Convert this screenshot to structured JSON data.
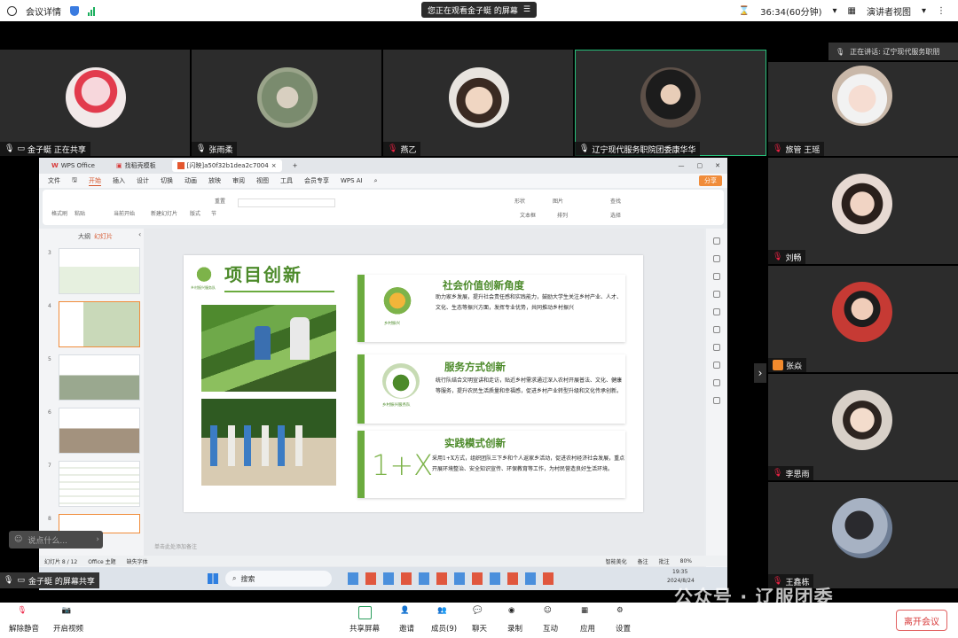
{
  "topbar": {
    "meeting_details": "会议详情",
    "viewing_notice": "您正在观看金子蜓 的屏幕",
    "timer": "36:34(60分钟)",
    "view_mode": "演讲者视图"
  },
  "speaker_bar": {
    "text": "正在讲话: 辽宁现代服务职朋"
  },
  "participants_top": [
    {
      "name": "金子蜓 正在共享"
    },
    {
      "name": "张雨柔"
    },
    {
      "name": "燕乙"
    },
    {
      "name": "辽宁现代服务职院团委康华华"
    }
  ],
  "participants_right": [
    {
      "name": "旅管 王瑶"
    },
    {
      "name": "刘畅"
    },
    {
      "name": "张焱"
    },
    {
      "name": "李思雨"
    },
    {
      "name": "王鑫栋"
    }
  ],
  "wps": {
    "tabs": [
      "WPS Office",
      "找稻壳模板",
      "[闪映]a50f32b1dea2c7004"
    ],
    "menu": [
      "文件",
      "开始",
      "插入",
      "设计",
      "切换",
      "动画",
      "放映",
      "审阅",
      "视图",
      "工具",
      "会员专享",
      "WPS AI"
    ],
    "share_btn": "分享",
    "ribbon": [
      "格式刷",
      "粘贴",
      "当前开始",
      "新建幻灯片",
      "版式",
      "节",
      "重置"
    ],
    "ribbon_right": [
      "形状",
      "图片",
      "查找",
      "文本框",
      "排列",
      "选择"
    ],
    "pane_tabs": [
      "大纲",
      "幻灯片"
    ],
    "thumb_numbers": [
      "3",
      "4",
      "5",
      "6",
      "7",
      "8"
    ],
    "notes_placeholder": "单击此处添加备注",
    "status": [
      "幻灯片 8 / 12",
      "Office 主题",
      "缺失字体"
    ],
    "status_right": [
      "智能美化",
      "备注",
      "批注",
      "80%"
    ],
    "taskbar": {
      "search": "搜索",
      "time": "19:35",
      "date": "2024/8/24"
    }
  },
  "slide": {
    "title": "项目创新",
    "logo_caption": "乡村振兴",
    "ribbon_logo_caption": "乡村振兴服务队",
    "cards": [
      {
        "title": "社会价值创新角度",
        "body": "助力家乡发展，提升社会责任感和实践能力，鼓励大学生关注乡村产业、人才、文化、生态等振兴方面，发挥专业优势，共同推动乡村振兴"
      },
      {
        "title": "服务方式创新",
        "body": "统行队结合文明宣讲和走访，贴近乡村需求通过深入农村开展普法、文化、健康等服务，提升农民生活质量和幸福感，促进乡村产业转型升级和文化传承创新。"
      },
      {
        "title": "实践模式创新",
        "body": "采用1+X方式，组织团队三下乡和个人返家乡活动，促进农村经济社会发展，重点开展环境整治、安全知识宣传、环保教育等工作，为村民营造良好生活环境。"
      }
    ],
    "one_plus_x": "1+X"
  },
  "chat_placeholder": "说点什么...",
  "share_label": "金子蜓 的屏幕共享",
  "watermark": "公众号 · 辽服团委",
  "bottom": {
    "mute": "解除静音",
    "video": "开启视频",
    "share": "共享屏幕",
    "invite": "邀请",
    "members": "成员(9)",
    "chat": "聊天",
    "record": "录制",
    "interact": "互动",
    "apps": "应用",
    "settings": "设置",
    "leave": "离开会议"
  },
  "colors": {
    "accent_green": "#27c07a",
    "slide_green": "#6bab3e",
    "wps_orange": "#f08c3a",
    "leave_red": "#d83b3b"
  }
}
